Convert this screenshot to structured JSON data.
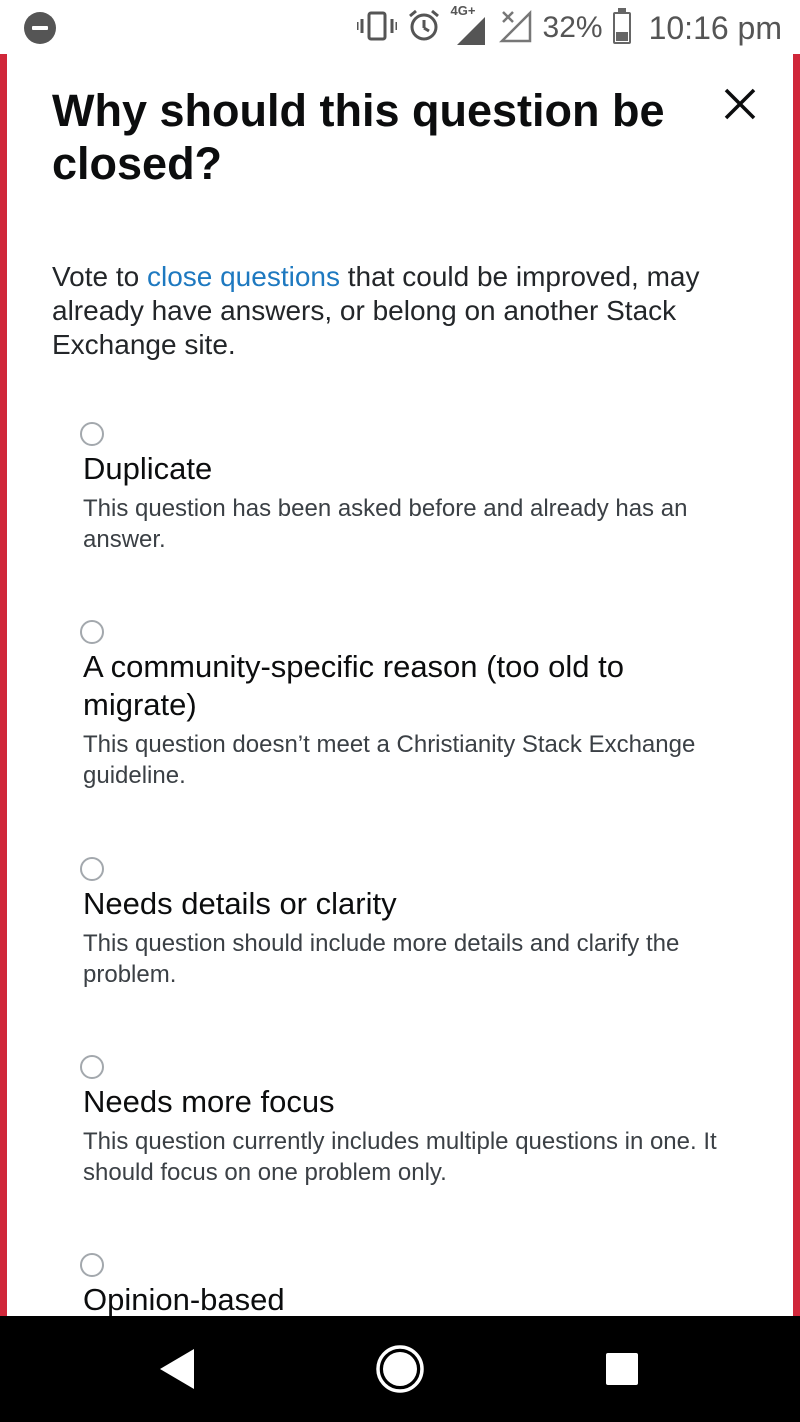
{
  "status_bar": {
    "battery_percent": "32%",
    "time": "10:16 pm",
    "network_label": "4G+",
    "icons": [
      "do-not-disturb-icon",
      "vibrate-icon",
      "alarm-icon",
      "signal-4g-icon",
      "no-signal-icon",
      "battery-icon"
    ]
  },
  "dialog": {
    "title": "Why should this question be closed?",
    "close_icon": "close-icon",
    "intro_before": "Vote to ",
    "intro_link": "close questions",
    "intro_after": " that could be improved, may already have answers, or belong on another Stack Exchange site.",
    "options": [
      {
        "label": "Duplicate",
        "description": "This question has been asked before and already has an answer.",
        "selected": false
      },
      {
        "label": "A community-specific reason (too old to migrate)",
        "description": "This question doesn’t meet a Christianity Stack Exchange guideline.",
        "selected": false
      },
      {
        "label": "Needs details or clarity",
        "description": "This question should include more details and clarify the problem.",
        "selected": false
      },
      {
        "label": "Needs more focus",
        "description": "This question currently includes multiple questions in one. It should focus on one problem only.",
        "selected": false
      },
      {
        "label": "Opinion-based",
        "description": "",
        "selected": false
      }
    ]
  },
  "colors": {
    "accent_red": "#d0273a",
    "link_blue": "#1e79c0",
    "radio_border": "#a3a8ad"
  },
  "nav_bar": {
    "buttons": [
      "back-icon",
      "home-icon",
      "recents-icon"
    ]
  }
}
